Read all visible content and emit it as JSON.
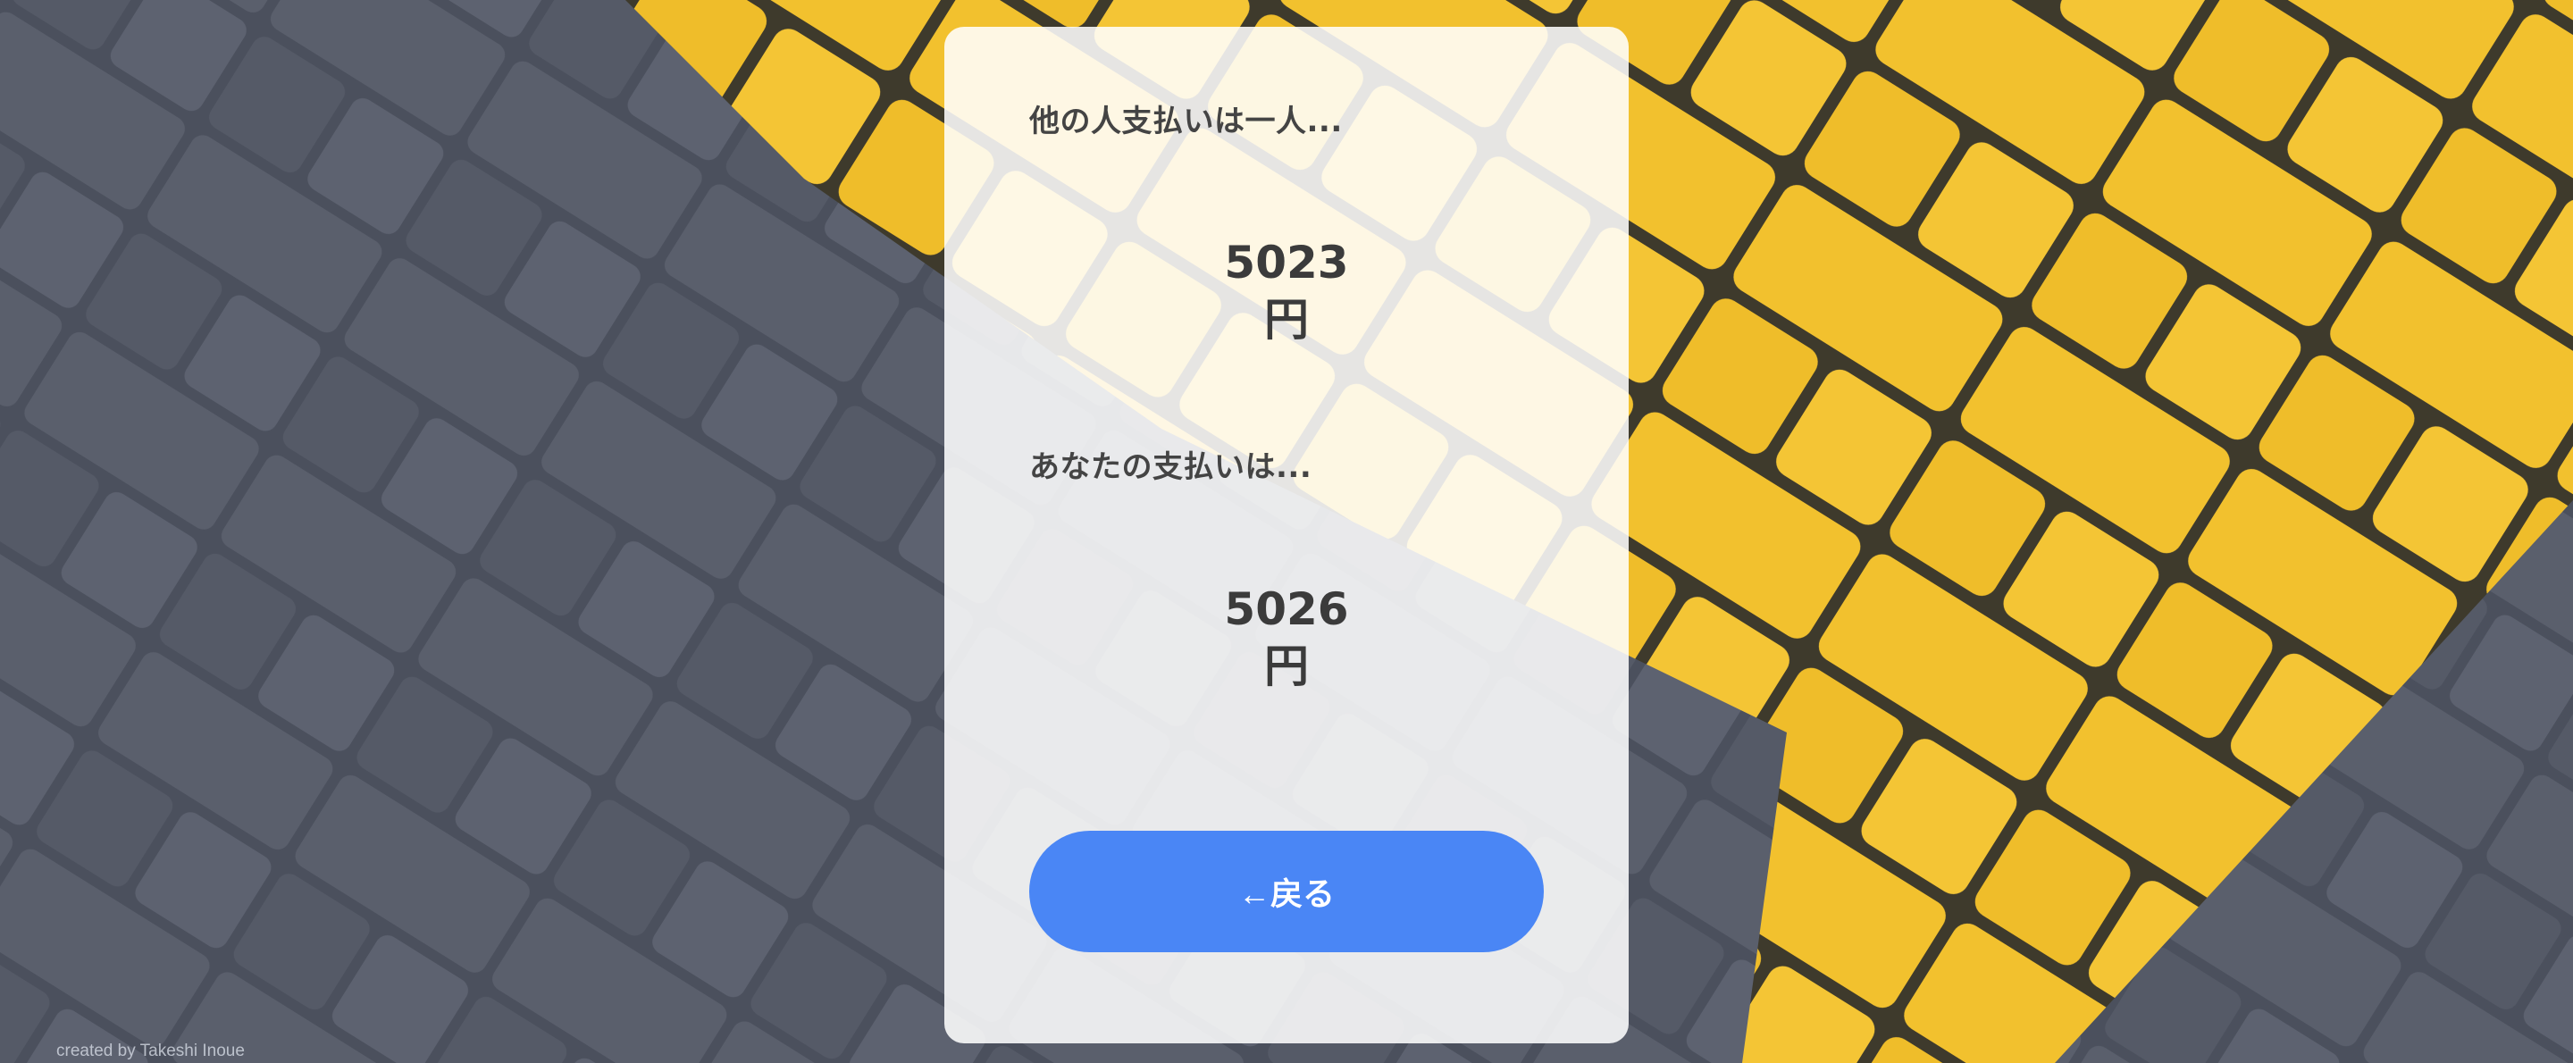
{
  "card": {
    "other_label": "他の人支払いは一人...",
    "other_amount": "5023",
    "other_unit": "円",
    "your_label": "あなたの支払いは...",
    "your_amount": "5026",
    "your_unit": "円",
    "back_button_label": "←戻る"
  },
  "footer": {
    "credit": "created by Takeshi Inoue"
  },
  "colors": {
    "button": "#4a86f5",
    "pavement_dark": "#4a4f5c",
    "pavement_yellow": "#f2c12e"
  }
}
